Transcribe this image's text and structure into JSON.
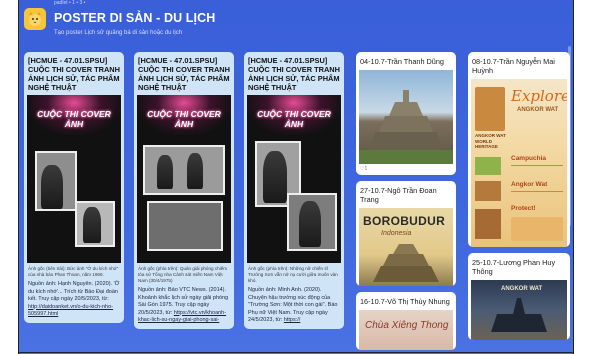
{
  "header": {
    "top_strip": "padlet • 1 • 3 •",
    "top_tag": "",
    "title": "POSTER DI SẢN - DU LỊCH",
    "subtitle": "Tạo poster Lịch sử quảng bá di sản hoặc du lịch"
  },
  "colors": {
    "board_bg": "#3f67de",
    "card_blue": "#cfe4f7",
    "logo": "#f5c53a"
  },
  "cards": [
    {
      "title": "[HCMUE - 47.01.SPSU] CUỘC THI COVER TRANH ẢNH LỊCH SỬ, TÁC PHẨM NGHỆ THUẬT",
      "banner": "CUỘC THI COVER ẢNH",
      "caption": "Ảnh gốc (bên trái): Bức ảnh \"Ở du kích nhớ\" của nhà báo Phan Thoan, năm 1968.",
      "source": "Nguồn ảnh: Hạnh Nguyên. (2020). 'Ở du kích nhớ'... Trích từ Báo Đại đoàn kết. Truy cập ngày 20/5/2023, từ:",
      "link": "http://daidoanket.vn/o-du-kich-nho-505997.html"
    },
    {
      "title": "[HCMUE - 47.01.SPSU] CUỘC THI COVER TRANH ẢNH LỊCH SỬ, TÁC PHẨM NGHỆ THUẬT",
      "banner": "CUỘC THI COVER ẢNH",
      "caption": "Ảnh gốc (phía trên): Quân giải phóng chiếm tòa sứ Tổng nha Cảnh sát miền Nam Việt Nam (30/4/1975)",
      "source": "Nguồn ảnh: Báo VTC News. (2014). Khoảnh khắc lịch sử ngày giải phóng Sài Gòn 1975. Truy cập ngày 20/5/2023, từ:",
      "link": "https://vtc.vn/khoanh-khac-lich-su-ngay-giai-phong-sai-"
    },
    {
      "title": "[HCMUE - 47.01.SPSU] CUỘC THI COVER TRANH ẢNH LỊCH SỬ, TÁC PHẨM NGHỆ THUẬT",
      "banner": "CUỘC THI COVER ẢNH",
      "caption": "Ảnh gốc (phía trên): Những nữ chiến sĩ Trường Sơn vẫn nở nụ cười giữa muôn vàn khó.",
      "source": "Nguồn ảnh: Minh Anh. (2020). Chuyện hậu trường xúc động của \"Trường Sơn: Một thời con gái\". Báo Phụ nữ Việt Nam. Truy cập ngày 24/5/2023, từ:",
      "link": "https://"
    }
  ],
  "col4": [
    {
      "title": "04-10.7-Trần Thanh Dũng",
      "likes": "♡1"
    },
    {
      "title": "27-10.7-Ngô Trần Đoan Trang",
      "poster_text": "BOROBUDUR",
      "poster_sub": "Indonesia"
    },
    {
      "title": "16-10.7-Võ Thị Thùy Nhung",
      "poster_text": "Chùa Xiêng Thong"
    }
  ],
  "col5": [
    {
      "title": "08-10.7-Trần Nguyễn Mai Huỳnh",
      "explore": "Explore",
      "explore_sub": "ANGKOR WAT",
      "heritage": "ANGKOR WAT WORLD HERITAGE",
      "sections": [
        "Campuchia",
        "Angkor Wat",
        "Protect!"
      ]
    },
    {
      "title": "25-10.7-Lương Phan Huy Thông",
      "poster_text": "ANGKOR WAT"
    }
  ]
}
